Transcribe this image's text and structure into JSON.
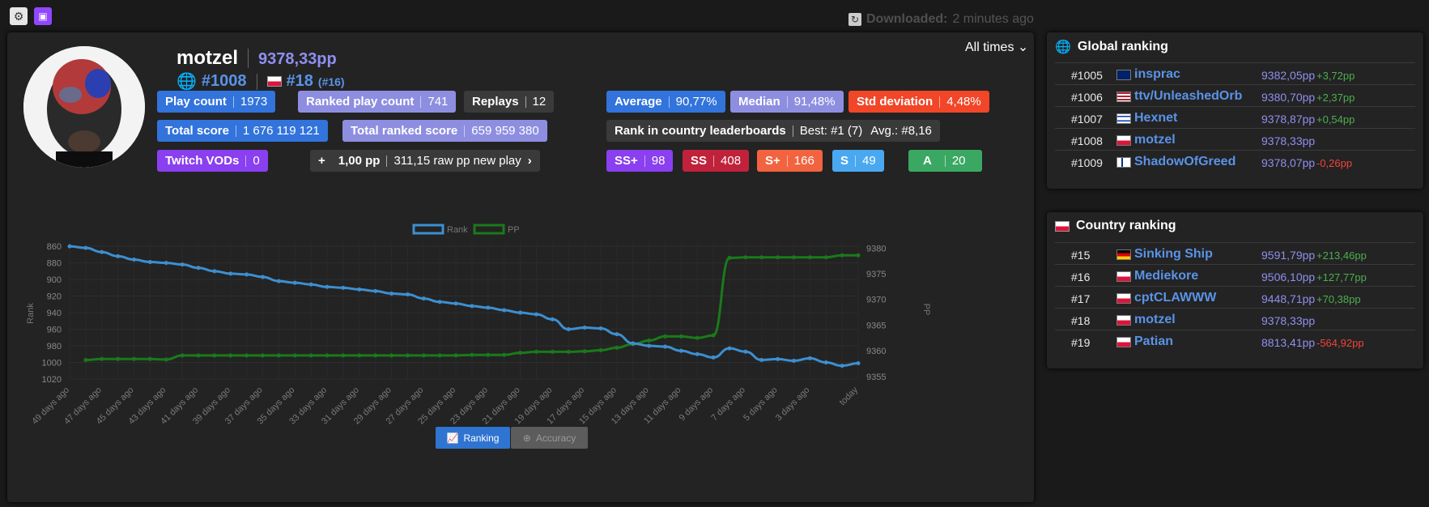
{
  "topbar": {
    "downloaded_label": "Downloaded:",
    "downloaded_value": "2 minutes ago"
  },
  "profile": {
    "username": "motzel",
    "pp": "9378,33pp",
    "global_rank": "#1008",
    "country_rank": "#18",
    "country_rank_alt": "(#16)",
    "period": "All times"
  },
  "stats": {
    "play_count": {
      "label": "Play count",
      "value": "1973"
    },
    "ranked_play_count": {
      "label": "Ranked play count",
      "value": "741"
    },
    "replays": {
      "label": "Replays",
      "value": "12"
    },
    "total_score": {
      "label": "Total score",
      "value": "1 676 119 121"
    },
    "total_ranked_score": {
      "label": "Total ranked score",
      "value": "659 959 380"
    },
    "twitch_vods": {
      "label": "Twitch VODs",
      "value": "0"
    },
    "pp_plus": {
      "plus": "+",
      "pp": "1,00 pp",
      "text": "311,15 raw pp new play"
    },
    "average": {
      "label": "Average",
      "value": "90,77%"
    },
    "median": {
      "label": "Median",
      "value": "91,48%"
    },
    "std": {
      "label": "Std deviation",
      "value": "4,48%"
    },
    "country_lb": {
      "label": "Rank in country leaderboards",
      "best": "Best: #1 (7)",
      "avg": "Avg.: #8,16"
    },
    "ssplus": {
      "label": "SS+",
      "value": "98"
    },
    "ss": {
      "label": "SS",
      "value": "408"
    },
    "splus": {
      "label": "S+",
      "value": "166"
    },
    "s": {
      "label": "S",
      "value": "49"
    },
    "a": {
      "label": "A",
      "value": "20"
    }
  },
  "chart_data": {
    "type": "line",
    "legend": [
      "Rank",
      "PP"
    ],
    "ylabel_left": "Rank",
    "ylabel_right": "PP",
    "rank_ticks": [
      "860",
      "880",
      "900",
      "920",
      "940",
      "960",
      "980",
      "1000",
      "1020"
    ],
    "pp_ticks": [
      "9380",
      "9375",
      "9370",
      "9365",
      "9360",
      "9355"
    ],
    "ylim_rank": [
      1020,
      856
    ],
    "ylim_pp": [
      9354.5,
      9381
    ],
    "x": [
      "49 days ago",
      "48 days ago",
      "47 days ago",
      "46 days ago",
      "45 days ago",
      "44 days ago",
      "43 days ago",
      "42 days ago",
      "41 days ago",
      "40 days ago",
      "39 days ago",
      "38 days ago",
      "37 days ago",
      "36 days ago",
      "35 days ago",
      "34 days ago",
      "33 days ago",
      "32 days ago",
      "31 days ago",
      "30 days ago",
      "29 days ago",
      "28 days ago",
      "27 days ago",
      "26 days ago",
      "25 days ago",
      "24 days ago",
      "23 days ago",
      "22 days ago",
      "21 days ago",
      "20 days ago",
      "19 days ago",
      "18 days ago",
      "17 days ago",
      "16 days ago",
      "15 days ago",
      "14 days ago",
      "13 days ago",
      "12 days ago",
      "11 days ago",
      "10 days ago",
      "9 days ago",
      "8 days ago",
      "7 days ago",
      "6 days ago",
      "5 days ago",
      "4 days ago",
      "3 days ago",
      "2 days ago",
      "1 days ago",
      "today"
    ],
    "x_tick_labels": [
      "49 days ago",
      "47 days ago",
      "45 days ago",
      "43 days ago",
      "41 days ago",
      "39 days ago",
      "37 days ago",
      "35 days ago",
      "33 days ago",
      "31 days ago",
      "29 days ago",
      "27 days ago",
      "25 days ago",
      "23 days ago",
      "21 days ago",
      "19 days ago",
      "17 days ago",
      "15 days ago",
      "13 days ago",
      "11 days ago",
      "9 days ago",
      "7 days ago",
      "5 days ago",
      "3 days ago",
      "today"
    ],
    "series": [
      {
        "name": "Rank",
        "color": "#3d8fd0",
        "values": [
          860,
          862,
          867,
          872,
          876,
          879,
          880,
          882,
          886,
          890,
          893,
          894,
          897,
          902,
          904,
          906,
          909,
          910,
          912,
          914,
          917,
          918,
          923,
          927,
          929,
          932,
          934,
          937,
          940,
          942,
          948,
          960,
          958,
          959,
          966,
          977,
          980,
          981,
          986,
          990,
          994,
          983,
          987,
          997,
          996,
          998,
          995,
          1000,
          1004,
          1001
        ]
      },
      {
        "name": "PP",
        "color": "#1a7a1a",
        "values": [
          null,
          9358.2,
          9358.4,
          9358.4,
          9358.4,
          9358.4,
          9358.3,
          9359.1,
          9359.1,
          9359.1,
          9359.1,
          9359.1,
          9359.1,
          9359.1,
          9359.1,
          9359.1,
          9359.1,
          9359.1,
          9359.1,
          9359.1,
          9359.1,
          9359.1,
          9359.1,
          9359.1,
          9359.1,
          9359.2,
          9359.2,
          9359.2,
          9359.6,
          9359.8,
          9359.8,
          9359.8,
          9359.9,
          9360.1,
          9360.6,
          9361.3,
          9362.0,
          9362.8,
          9362.8,
          9362.5,
          9363.0,
          9378.1,
          9378.2,
          9378.2,
          9378.2,
          9378.2,
          9378.2,
          9378.2,
          9378.6,
          9378.6
        ]
      }
    ]
  },
  "chart_buttons": {
    "ranking": "Ranking",
    "accuracy": "Accuracy"
  },
  "global_ranking": {
    "title": "Global ranking",
    "rows": [
      {
        "rank": "#1005",
        "player": "insprac",
        "pp": "9382,05pp",
        "diff": "+3,72pp",
        "flag": "nz"
      },
      {
        "rank": "#1006",
        "player": "ttv/UnleashedOrb",
        "pp": "9380,70pp",
        "diff": "+2,37pp",
        "flag": "us"
      },
      {
        "rank": "#1007",
        "player": "Hexnet",
        "pp": "9378,87pp",
        "diff": "+0,54pp",
        "flag": "il"
      },
      {
        "rank": "#1008",
        "player": "motzel",
        "pp": "9378,33pp",
        "diff": "",
        "flag": "pl"
      },
      {
        "rank": "#1009",
        "player": "ShadowOfGreed",
        "pp": "9378,07pp",
        "diff": "-0,26pp",
        "flag": "fi"
      }
    ]
  },
  "country_ranking": {
    "title": "Country ranking",
    "rows": [
      {
        "rank": "#15",
        "player": "Sinking Ship",
        "pp": "9591,79pp",
        "diff": "+213,46pp",
        "flag": "de"
      },
      {
        "rank": "#16",
        "player": "Mediekore",
        "pp": "9506,10pp",
        "diff": "+127,77pp",
        "flag": "pl"
      },
      {
        "rank": "#17",
        "player": "cptCLAWWW",
        "pp": "9448,71pp",
        "diff": "+70,38pp",
        "flag": "pl"
      },
      {
        "rank": "#18",
        "player": "motzel",
        "pp": "9378,33pp",
        "diff": "",
        "flag": "pl"
      },
      {
        "rank": "#19",
        "player": "Patian",
        "pp": "8813,41pp",
        "diff": "-564,92pp",
        "flag": "pl"
      }
    ]
  }
}
